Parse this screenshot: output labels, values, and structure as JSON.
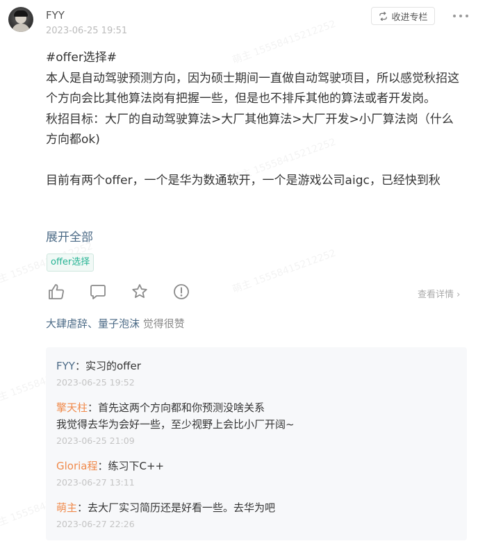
{
  "watermark": "萌主 15558415212252",
  "post": {
    "author": "FYY",
    "timestamp": "2023-06-25 19:51",
    "collect_label": "收进专栏",
    "content_lines": [
      "#offer选择#",
      "本人是自动驾驶预测方向，因为硕士期间一直做自动驾驶项目，所以感觉秋招这个方向会比其他算法岗有把握一些，但是也不排斥其他的算法或者开发岗。",
      "秋招目标：大厂的自动驾驶算法>大厂其他算法>大厂开发>小厂算法岗（什么方向都ok)",
      "",
      "目前有两个offer，一个是华为数通软开，一个是游戏公司aigc，已经快到秋"
    ],
    "expand_label": "展开全部",
    "tag": "offer选择",
    "view_detail": "查看详情",
    "liked_by": "大肆虐辞、量子泡沫",
    "liked_suffix": "觉得很赞"
  },
  "comments": [
    {
      "author": "FYY",
      "text": "：实习的offer",
      "date": "2023-06-25 19:52"
    },
    {
      "author": "擎天柱",
      "text": "：首先这两个方向都和你预测没啥关系",
      "text2": "我觉得去华为会好一些，至少视野上会比小厂开阔~",
      "date": "2023-06-25 21:09"
    },
    {
      "author": "Gloria程",
      "text": "：练习下C++",
      "date": "2023-06-27 13:11"
    },
    {
      "author": "萌主",
      "text": "：去大厂实习简历还是好看一些。去华为吧",
      "date": "2023-06-27 22:26"
    }
  ],
  "colors": {
    "link": "#4b6a86",
    "highlight_name": "#f08a4b",
    "tag_text": "#26b394"
  }
}
